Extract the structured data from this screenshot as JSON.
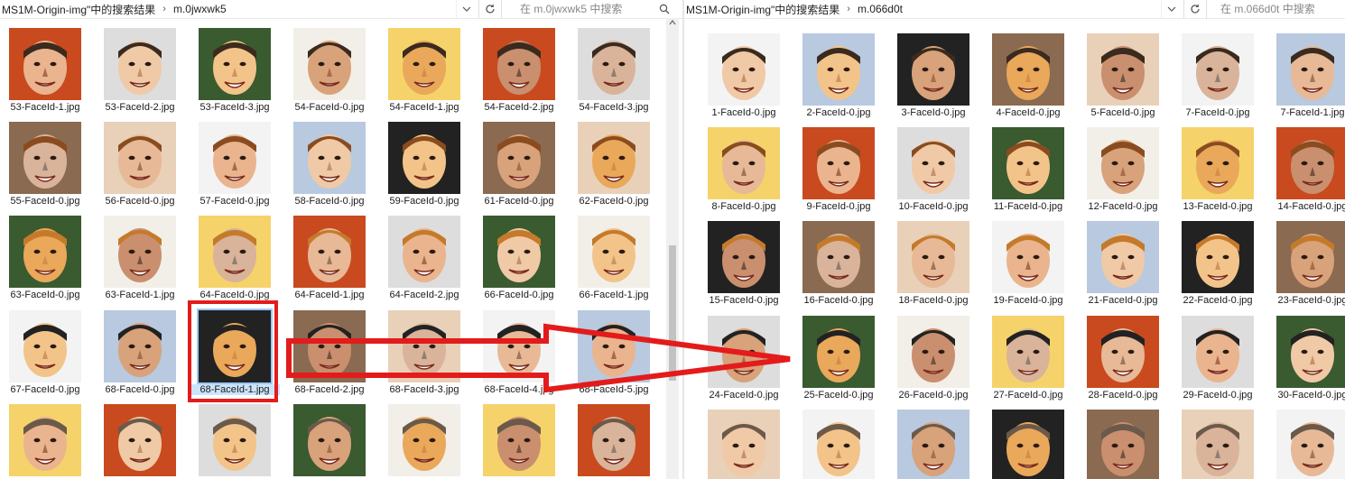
{
  "left_window": {
    "breadcrumb": [
      "MS1M-Origin-img\"中的搜索结果",
      "m.0jwxwk5"
    ],
    "search_placeholder": "在 m.0jwxwk5 中搜索",
    "rows": [
      [
        "53-FaceId-1.jpg",
        "53-FaceId-2.jpg",
        "53-FaceId-3.jpg",
        "54-FaceId-0.jpg",
        "54-FaceId-1.jpg",
        "54-FaceId-2.jpg",
        "54-FaceId-3.jpg"
      ],
      [
        "55-FaceId-0.jpg",
        "56-FaceId-0.jpg",
        "57-FaceId-0.jpg",
        "58-FaceId-0.jpg",
        "59-FaceId-0.jpg",
        "61-FaceId-0.jpg",
        "62-FaceId-0.jpg"
      ],
      [
        "63-FaceId-0.jpg",
        "63-FaceId-1.jpg",
        "64-FaceId-0.jpg",
        "64-FaceId-1.jpg",
        "64-FaceId-2.jpg",
        "66-FaceId-0.jpg",
        "66-FaceId-1.jpg"
      ],
      [
        "67-FaceId-0.jpg",
        "68-FaceId-0.jpg",
        "68-FaceId-1.jpg",
        "68-FaceId-2.jpg",
        "68-FaceId-3.jpg",
        "68-FaceId-4.jpg",
        "68-FaceId-5.jpg"
      ],
      [
        "",
        "",
        "",
        "",
        "",
        "",
        ""
      ]
    ],
    "selected_file": "68-FaceId-1.jpg"
  },
  "right_window": {
    "breadcrumb": [
      "MS1M-Origin-img\"中的搜索结果",
      "m.066d0t"
    ],
    "search_placeholder": "在 m.066d0t 中搜索",
    "rows": [
      [
        "1-FaceId-0.jpg",
        "2-FaceId-0.jpg",
        "3-FaceId-0.jpg",
        "4-FaceId-0.jpg",
        "5-FaceId-0.jpg",
        "7-FaceId-0.jpg",
        "7-FaceId-1.jpg"
      ],
      [
        "8-FaceId-0.jpg",
        "9-FaceId-0.jpg",
        "10-FaceId-0.jpg",
        "11-FaceId-0.jpg",
        "12-FaceId-0.jpg",
        "13-FaceId-0.jpg",
        "14-FaceId-0.jpg"
      ],
      [
        "15-FaceId-0.jpg",
        "16-FaceId-0.jpg",
        "18-FaceId-0.jpg",
        "19-FaceId-0.jpg",
        "21-FaceId-0.jpg",
        "22-FaceId-0.jpg",
        "23-FaceId-0.jpg"
      ],
      [
        "24-FaceId-0.jpg",
        "25-FaceId-0.jpg",
        "26-FaceId-0.jpg",
        "27-FaceId-0.jpg",
        "28-FaceId-0.jpg",
        "29-FaceId-0.jpg",
        "30-FaceId-0.jpg"
      ],
      [
        "",
        "",
        "",
        "",
        "",
        "",
        ""
      ]
    ]
  },
  "annotation_color": "#e31b1b",
  "selection_color": "#cce4fb"
}
